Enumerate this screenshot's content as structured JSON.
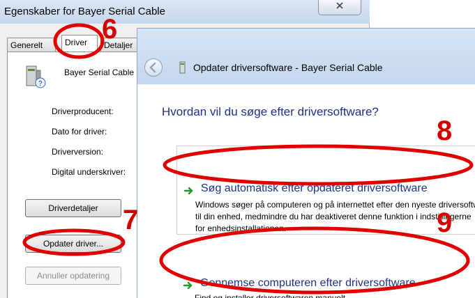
{
  "properties_window": {
    "title": "Egenskaber for Bayer Serial Cable",
    "close_label": "☒",
    "tabs": [
      {
        "label": "Generelt"
      },
      {
        "label": "Driver"
      },
      {
        "label": "Detaljer"
      }
    ],
    "device_name": "Bayer Serial Cable",
    "fields": {
      "provider": "Driverproducent:",
      "date": "Dato for driver:",
      "version": "Driverversion:",
      "signer": "Digital underskriver:"
    },
    "buttons": {
      "details": "Driverdetaljer",
      "update": "Opdater driver...",
      "rollback": "Annuller opdatering"
    }
  },
  "update_wizard": {
    "title": "Opdater driversoftware - Bayer Serial Cable",
    "question": "Hvordan vil du søge efter driversoftware?",
    "option_auto": {
      "title": "Søg automatisk efter opdateret driversoftware",
      "desc_line1": "Windows søger på computeren og på internettet efter den nyeste driversoftware",
      "desc_line2": "til din enhed, medmindre du har deaktiveret denne funktion i indstillingerne",
      "desc_line3": "for enhedsinstallationen."
    },
    "option_browse": {
      "title": "Gennemse computeren efter driversoftware",
      "desc": "Find og installer driversoftwaren manuelt."
    }
  },
  "annotations": {
    "step_6": "6",
    "step_7": "7",
    "step_8": "8",
    "step_9": "9",
    "circle_color": "#e00000"
  },
  "icons": {
    "arrow": "green-arrow-icon",
    "back": "back-arrow-icon",
    "device": "device-icon",
    "wizard": "device-small-icon"
  }
}
